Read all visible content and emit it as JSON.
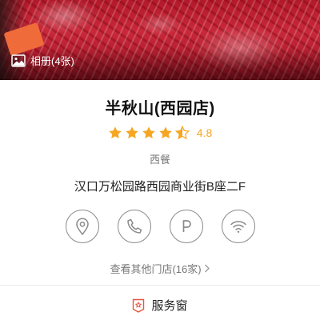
{
  "hero": {
    "album_label": "相册(4张)",
    "badge_text": "",
    "icon": "photo-album-icon"
  },
  "shop": {
    "name": "半秋山(西园店)",
    "rating": 4.8,
    "rating_text": "4.8",
    "stars_full": 4,
    "stars_half": 1,
    "category": "西餐",
    "address": "汉口万松园路西园商业街B座二F"
  },
  "actions": [
    {
      "icon": "location-pin-icon"
    },
    {
      "icon": "phone-icon"
    },
    {
      "icon": "parking-icon"
    },
    {
      "icon": "wifi-icon"
    }
  ],
  "other_stores": {
    "label": "查看其他门店(16家)"
  },
  "service_window": {
    "label": "服务窗",
    "icon": "service-window-icon"
  },
  "colors": {
    "star": "#f5a623",
    "service_icon": "#e8553e",
    "icon_stroke": "#8a8a8a"
  }
}
